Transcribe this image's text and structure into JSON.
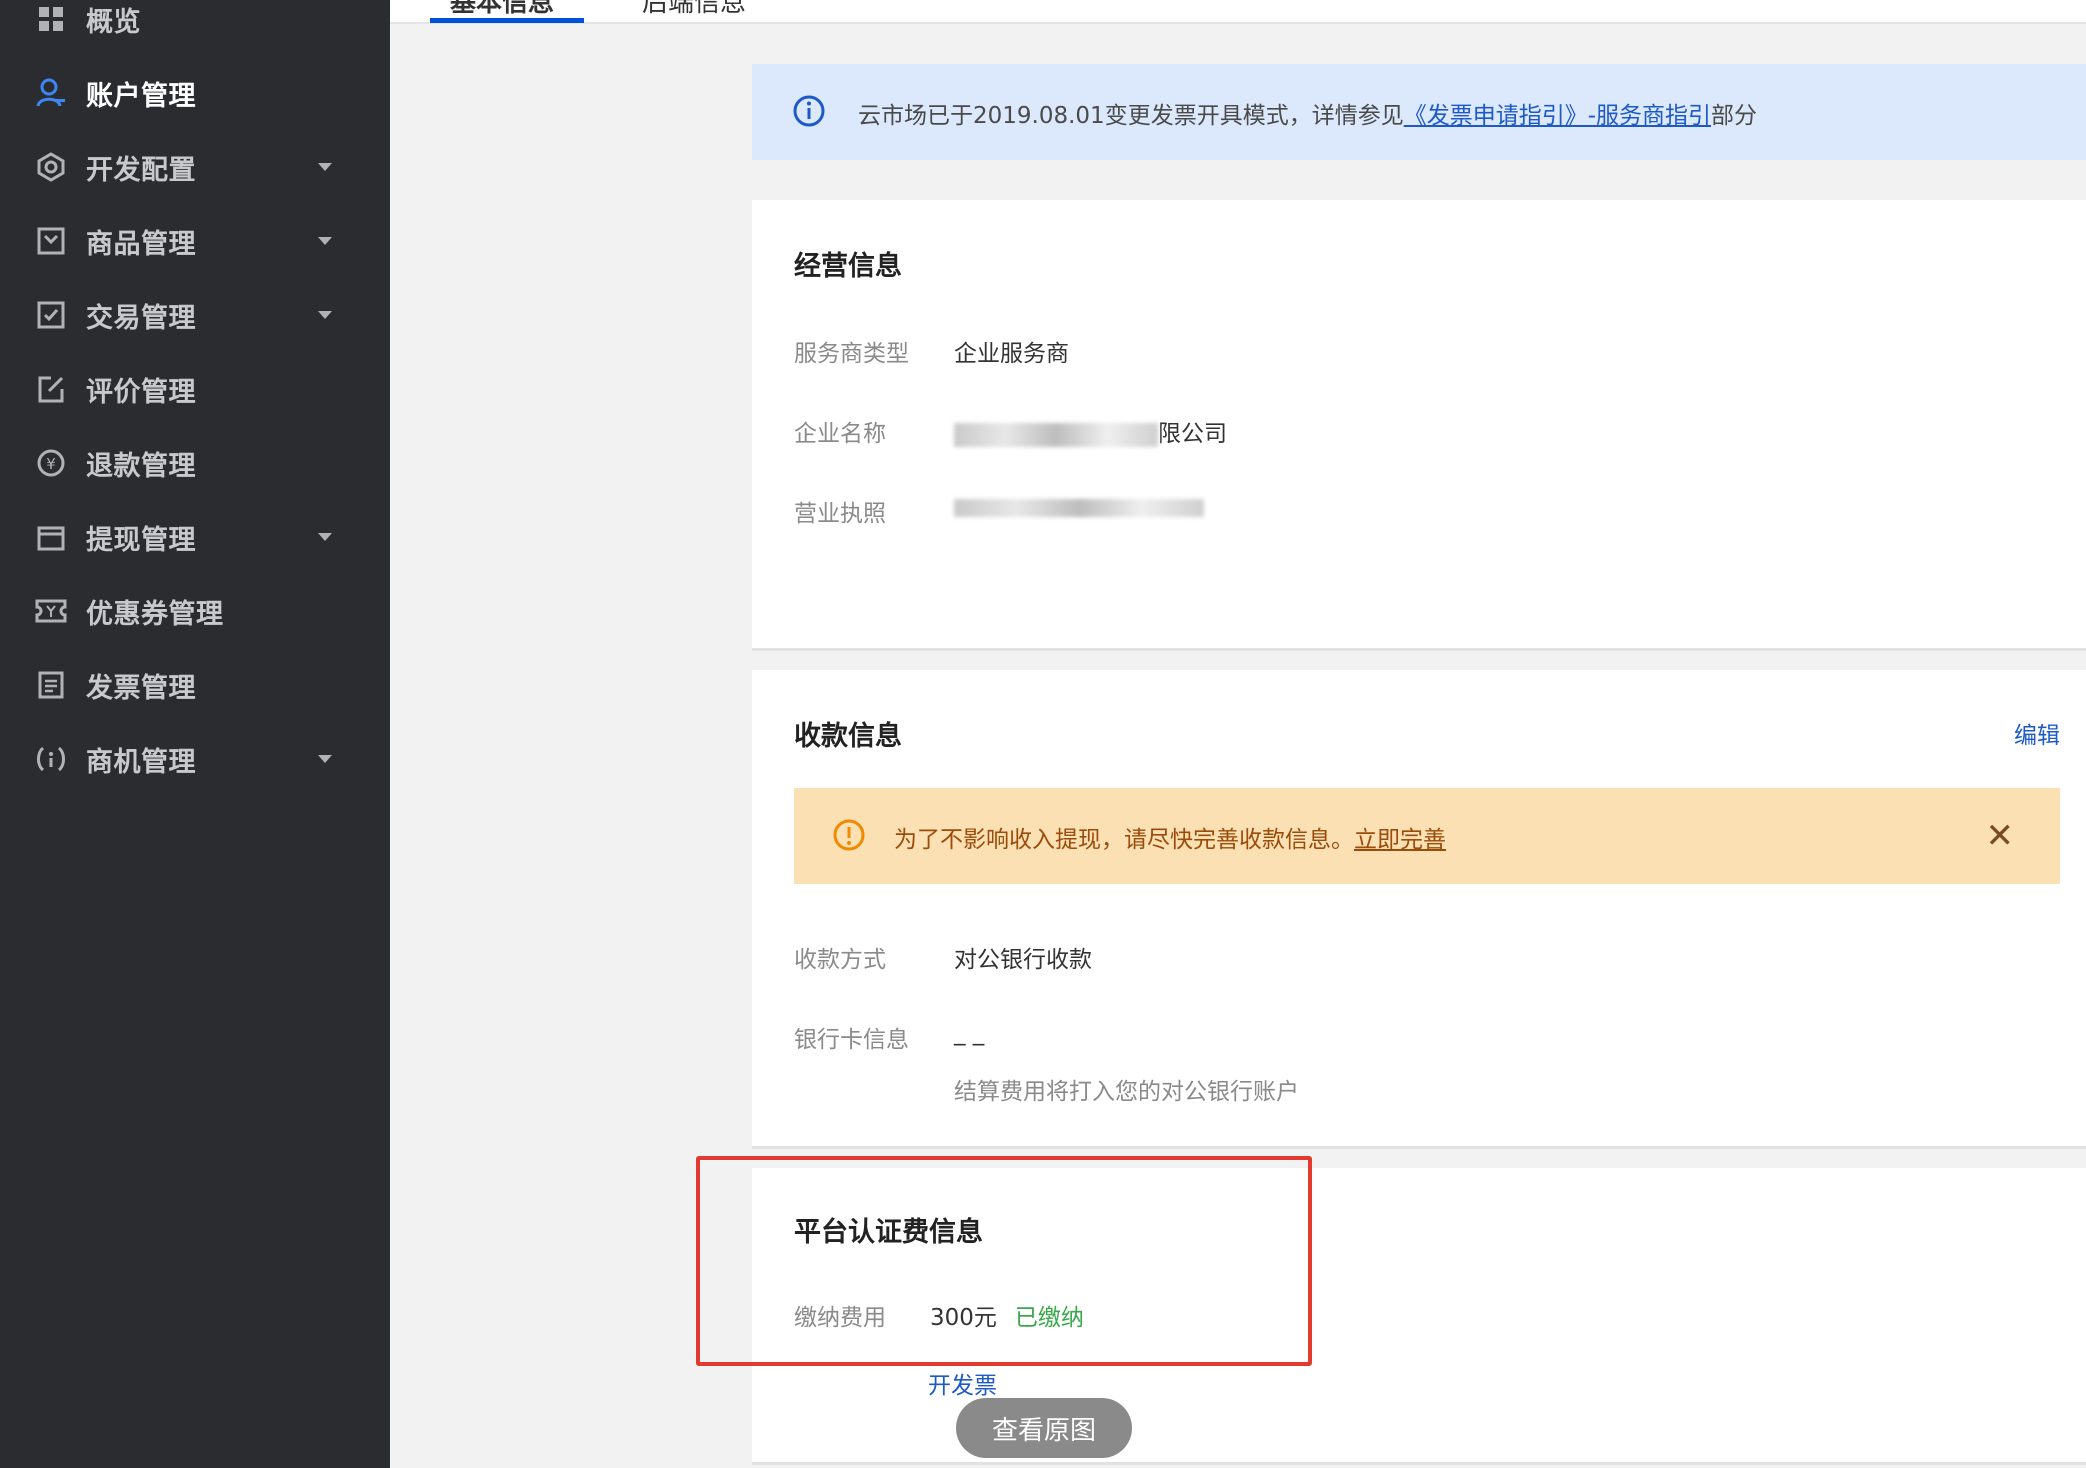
{
  "sidebar": {
    "items": [
      {
        "label": "概览",
        "icon": "dashboard-icon"
      },
      {
        "label": "账户管理",
        "icon": "user-icon",
        "active": true
      },
      {
        "label": "开发配置",
        "icon": "settings-icon"
      },
      {
        "label": "商品管理",
        "icon": "product-icon"
      },
      {
        "label": "交易管理",
        "icon": "transaction-icon"
      },
      {
        "label": "评价管理",
        "icon": "edit-icon"
      },
      {
        "label": "退款管理",
        "icon": "refund-icon"
      },
      {
        "label": "提现管理",
        "icon": "wallet-icon"
      },
      {
        "label": "优惠券管理",
        "icon": "coupon-icon"
      },
      {
        "label": "发票管理",
        "icon": "invoice-icon"
      },
      {
        "label": "商机管理",
        "icon": "opportunity-icon"
      }
    ]
  },
  "tabs": [
    {
      "label": "基本信息"
    },
    {
      "label": "后端信息"
    }
  ],
  "info_banner": {
    "text": "云市场已于2019.08.01变更发票开具模式，详情参见",
    "link1": "《发票申请指引》-服务商指引",
    "suffix": "部分"
  },
  "business": {
    "title": "经营信息",
    "fields": [
      {
        "label": "服务商类型",
        "value": "企业服务商"
      },
      {
        "label": "企业名称",
        "value": "限公司"
      },
      {
        "label": "营业执照",
        "value": ""
      }
    ]
  },
  "payment": {
    "title": "收款信息",
    "edit": "编辑",
    "warning": "为了不影响收入提现，请尽快完善收款信息。",
    "warning_link": "立即完善",
    "fields": [
      {
        "label": "收款方式",
        "value": "对公银行收款"
      },
      {
        "label": "银行卡信息",
        "value": "_ _"
      }
    ],
    "hint": "结算费用将打入您的对公银行账户"
  },
  "platform": {
    "title": "平台认证费信息",
    "fee_label": "缴纳费用",
    "fee_value": "300元",
    "status": "已缴纳",
    "invoice_link": "开发票"
  },
  "overlay": {
    "view_original": "查看原图"
  },
  "colors": {
    "sidebar_bg": "#2a2c2f",
    "accent": "#0052d9",
    "link": "#1d5ac8",
    "info_bg": "#dce8fb",
    "warn_bg": "#fbe0b4",
    "paid_green": "#39a84a",
    "highlight_red": "#e23a2e"
  }
}
